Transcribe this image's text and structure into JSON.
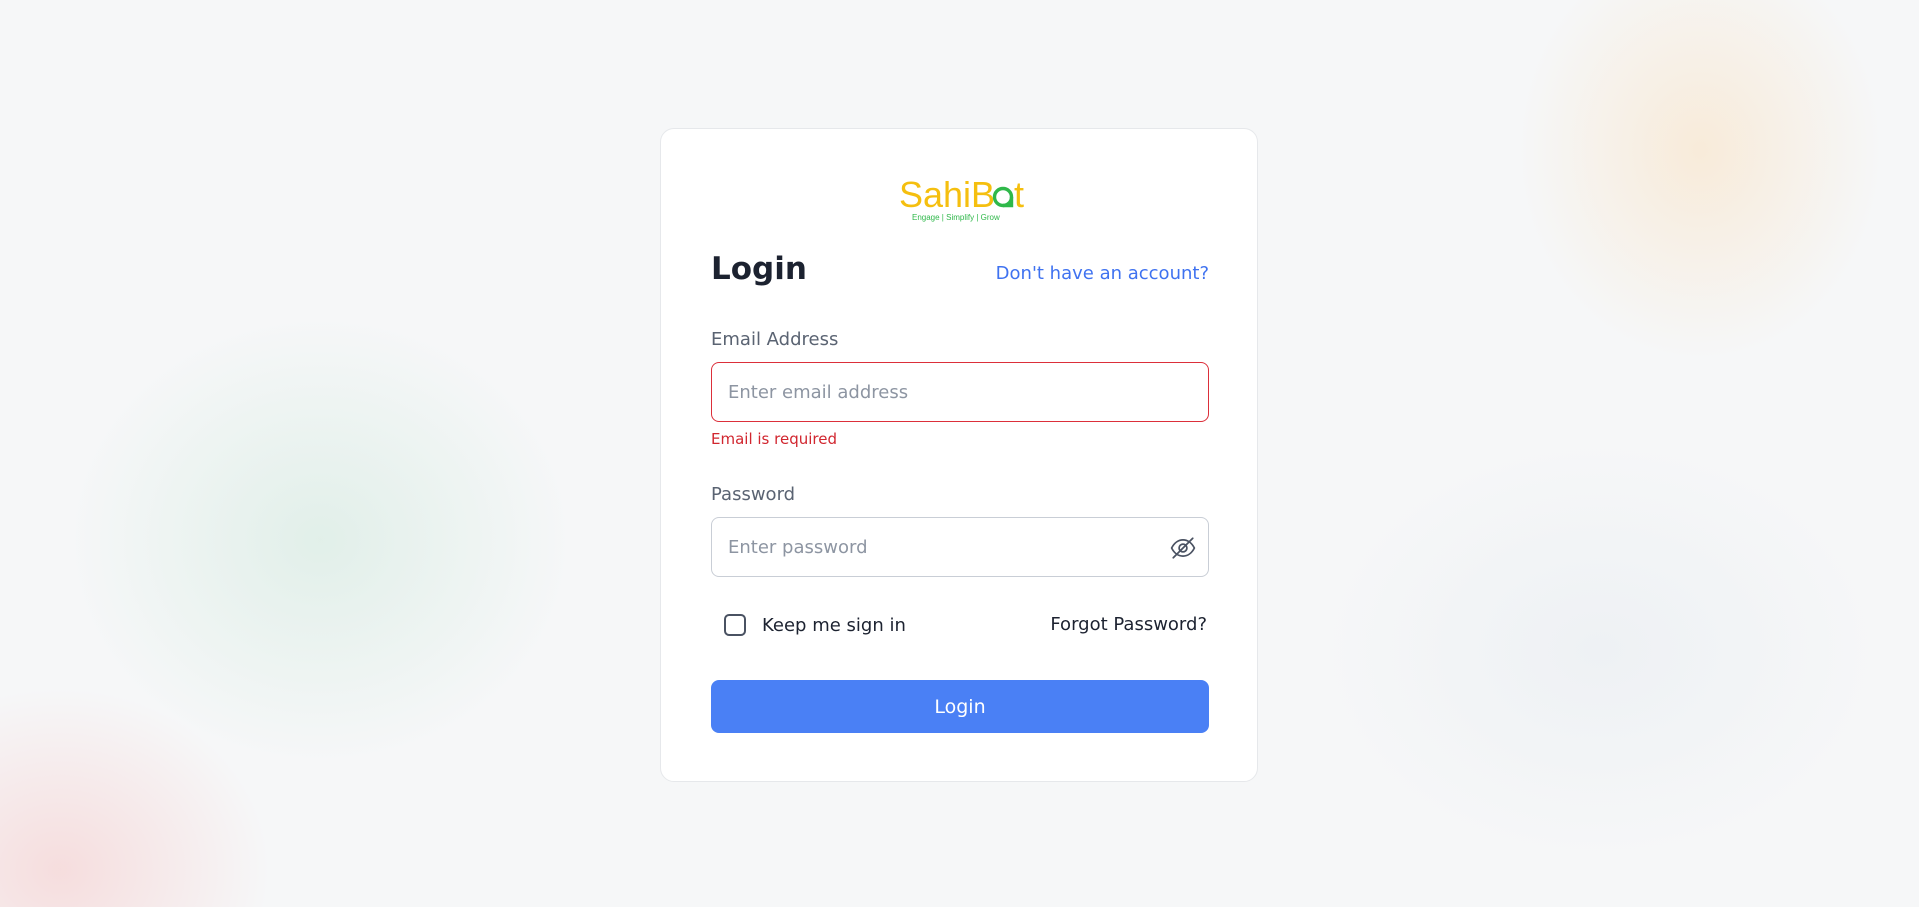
{
  "brand": {
    "name": "SahiBot",
    "tagline": "Engage | Simplify | Grow",
    "primary_color": "#f5bf0f",
    "accent_color": "#2fb84a"
  },
  "header": {
    "title": "Login",
    "signup_link": "Don't have an account?"
  },
  "email": {
    "label": "Email Address",
    "value": "",
    "placeholder": "Enter email address",
    "error": "Email is required",
    "error_color": "#d1262f"
  },
  "password": {
    "label": "Password",
    "value": "",
    "placeholder": "Enter password",
    "toggle_icon": "eye-slash-icon"
  },
  "remember": {
    "label": "Keep me sign in",
    "checked": false
  },
  "forgot_link": "Forgot Password?",
  "submit": {
    "label": "Login",
    "color": "#4a80f5"
  }
}
